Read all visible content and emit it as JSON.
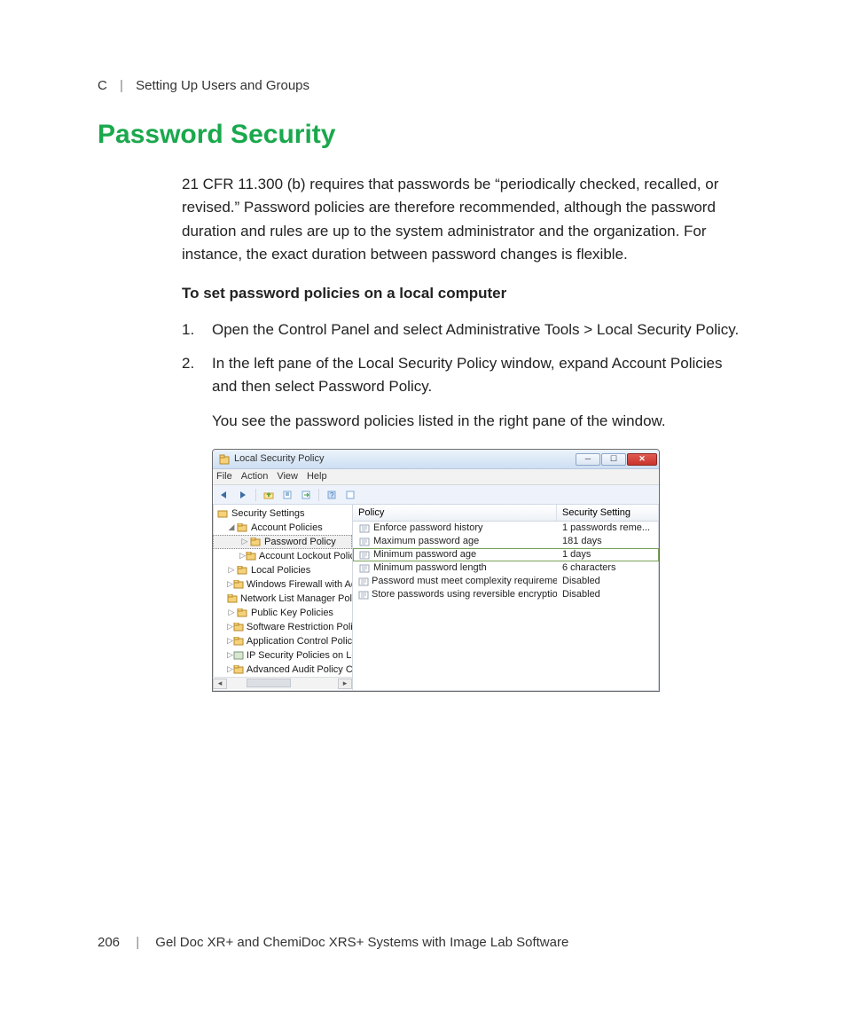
{
  "breadcrumb": {
    "section": "C",
    "title": "Setting Up Users and Groups"
  },
  "title": "Password Security",
  "intro": "21 CFR 11.300 (b) requires that passwords be “periodically checked, recalled, or revised.” Password policies are therefore recommended, although the password duration and rules are up to the system administrator and the organization. For instance, the exact duration between password changes is flexible.",
  "subhead": "To set password policies on a local computer",
  "steps": [
    {
      "num": "1.",
      "text": "Open the Control Panel and select Administrative Tools > Local Security Policy."
    },
    {
      "num": "2.",
      "text": "In the left pane of the Local Security Policy window, expand Account Policies and then select Password Policy."
    }
  ],
  "after_steps": "You see the password policies listed in the right pane of the window.",
  "footer": {
    "page": "206",
    "text": "Gel Doc XR+ and ChemiDoc XRS+ Systems with Image Lab Software"
  },
  "win": {
    "title": "Local Security Policy",
    "menu": [
      "File",
      "Action",
      "View",
      "Help"
    ],
    "tree": {
      "root": "Security Settings",
      "items": [
        {
          "label": "Account Policies",
          "expander": "◢",
          "indent": 1,
          "selected": false,
          "folder": true
        },
        {
          "label": "Password Policy",
          "expander": "▷",
          "indent": 2,
          "selected": true,
          "folder": true
        },
        {
          "label": "Account Lockout Policy",
          "expander": "▷",
          "indent": 2,
          "selected": false,
          "folder": true
        },
        {
          "label": "Local Policies",
          "expander": "▷",
          "indent": 1,
          "selected": false,
          "folder": true
        },
        {
          "label": "Windows Firewall with Advanc",
          "expander": "▷",
          "indent": 1,
          "selected": false,
          "folder": true
        },
        {
          "label": "Network List Manager Policies",
          "expander": "",
          "indent": 1,
          "selected": false,
          "folder": true
        },
        {
          "label": "Public Key Policies",
          "expander": "▷",
          "indent": 1,
          "selected": false,
          "folder": true
        },
        {
          "label": "Software Restriction Policies",
          "expander": "▷",
          "indent": 1,
          "selected": false,
          "folder": true
        },
        {
          "label": "Application Control Policies",
          "expander": "▷",
          "indent": 1,
          "selected": false,
          "folder": true
        },
        {
          "label": "IP Security Policies on Local C",
          "expander": "▷",
          "indent": 1,
          "selected": false,
          "folder": false
        },
        {
          "label": "Advanced Audit Policy Config",
          "expander": "▷",
          "indent": 1,
          "selected": false,
          "folder": true
        }
      ]
    },
    "list": {
      "headers": [
        "Policy",
        "Security Setting"
      ],
      "rows": [
        {
          "policy": "Enforce password history",
          "setting": "1 passwords reme...",
          "selected": false
        },
        {
          "policy": "Maximum password age",
          "setting": "181 days",
          "selected": false
        },
        {
          "policy": "Minimum password age",
          "setting": "1 days",
          "selected": true
        },
        {
          "policy": "Minimum password length",
          "setting": "6 characters",
          "selected": false
        },
        {
          "policy": "Password must meet complexity requirements",
          "setting": "Disabled",
          "selected": false
        },
        {
          "policy": "Store passwords using reversible encryption",
          "setting": "Disabled",
          "selected": false
        }
      ]
    }
  }
}
